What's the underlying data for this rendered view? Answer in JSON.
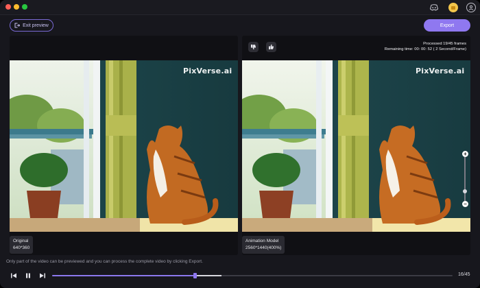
{
  "window": {
    "title": ""
  },
  "toolbar": {
    "exit_preview_label": "Exit preview",
    "export_label": "Export"
  },
  "panels": {
    "original": {
      "watermark": "PixVerse.ai",
      "caption_title": "Original",
      "caption_resolution": "640*360"
    },
    "result": {
      "watermark": "PixVerse.ai",
      "caption_title": "Animation Model",
      "caption_resolution": "2560*1440(400%)",
      "processed_text": "Processed 19/45 frames",
      "remaining_text": "Remaining time: 00: 00: 52 ( 2 Second/Frame)"
    }
  },
  "zoom": {
    "plus": "+",
    "minus": "−",
    "level": 0.22
  },
  "playback": {
    "hint": "Only part of the video can be previewed and you can process the complete video by clicking Export.",
    "frame_counter": "16/45",
    "current_frame": 16,
    "total_frames": 45,
    "processed_frames": 19
  },
  "icons": {
    "discord": "discord-icon",
    "coin": "coin-icon",
    "user": "user-icon",
    "exit": "exit-icon",
    "thumbs_down": "thumbs-down-icon",
    "thumbs_up": "thumbs-up-icon",
    "prev": "skip-back-icon",
    "pause": "pause-icon",
    "next": "skip-forward-icon"
  },
  "colors": {
    "accent": "#8f78f0",
    "background": "#17171d",
    "panel": "#101014"
  }
}
